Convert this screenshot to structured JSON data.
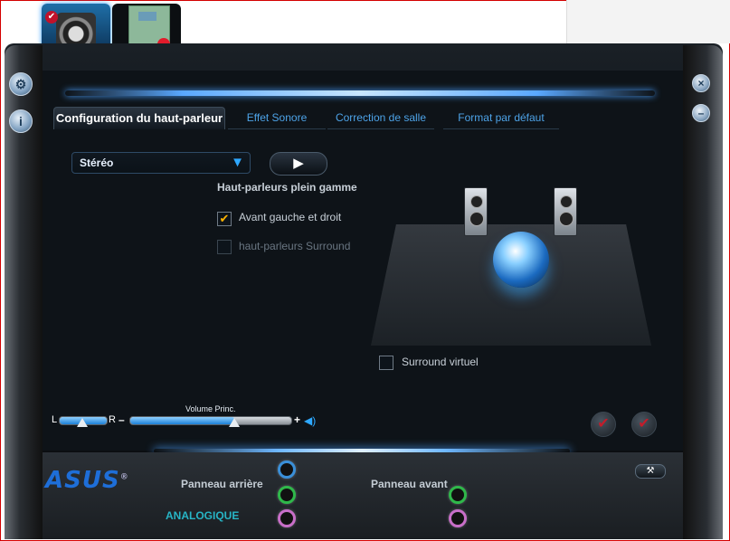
{
  "devices": [
    {
      "name": "speaker-device",
      "active": true
    },
    {
      "name": "digital-device",
      "active": false
    }
  ],
  "tabs": [
    {
      "label": "Configuration du haut-parleur",
      "active": true
    },
    {
      "label": "Effet Sonore",
      "active": false
    },
    {
      "label": "Correction de salle",
      "active": false
    },
    {
      "label": "Format par défaut",
      "active": false
    }
  ],
  "config": {
    "dropdown_value": "Stéréo",
    "play_symbol": "▶",
    "group_title": "Haut-parleurs plein gamme",
    "front_lr_label": "Avant gauche et droit",
    "front_lr_checked": true,
    "surround_label": "haut-parleurs Surround",
    "surround_checked": false,
    "virtual_surround_label": "Surround virtuel",
    "virtual_surround_checked": false
  },
  "volume": {
    "title": "Volume Princ.",
    "left_label": "L",
    "right_label": "R",
    "minus": "–",
    "plus": "+",
    "balance": 0.5,
    "level": 0.65
  },
  "bottom": {
    "logo": "ASUS",
    "rear_panel_label": "Panneau arrière",
    "front_panel_label": "Panneau avant",
    "analog_label": "ANALOGIQUE"
  },
  "colors": {
    "accent": "#2ea8ff",
    "tab_text": "#4da3e8",
    "analog_text": "#27b5c6",
    "logo": "#1e6ed8",
    "jack_blue": "#3a8fd8",
    "jack_green": "#2fb84a",
    "jack_pink": "#c86ec8"
  }
}
